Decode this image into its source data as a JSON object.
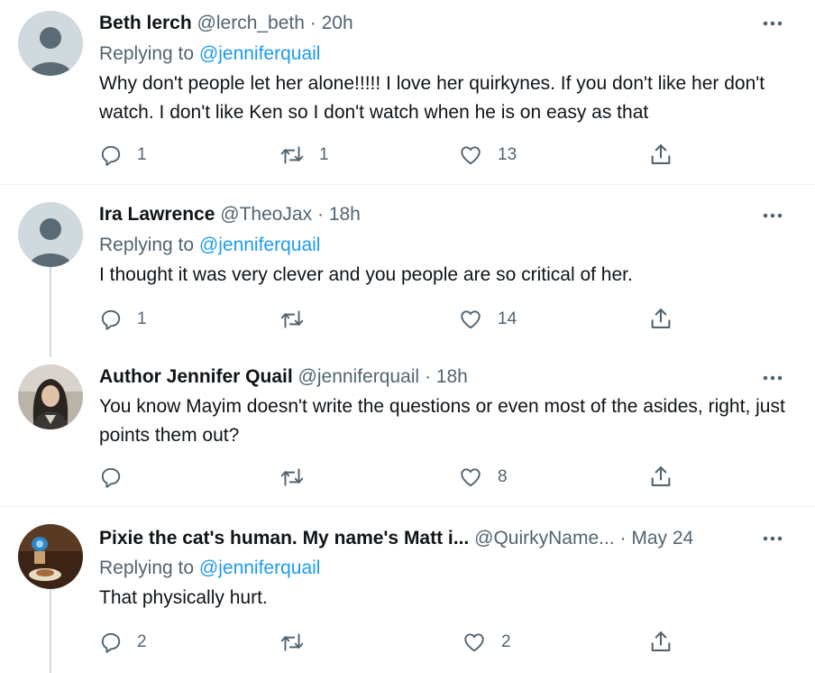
{
  "tweets": [
    {
      "display_name": "Beth lerch",
      "handle": "@lerch_beth",
      "time": "20h",
      "replying_label": "Replying to",
      "replying_to": "@jenniferquail",
      "text": "Why don't people let her alone!!!!! I love her quirkynes. If you don't like her don't watch. I don't like Ken so I don't watch when he is on easy as that",
      "reply_count": "1",
      "retweet_count": "1",
      "like_count": "13",
      "avatar": "default-avatar"
    },
    {
      "display_name": "Ira Lawrence",
      "handle": "@TheoJax",
      "time": "18h",
      "replying_label": "Replying to",
      "replying_to": "@jenniferquail",
      "text": "I thought it was very clever and you people are so critical of her.",
      "reply_count": "1",
      "retweet_count": "",
      "like_count": "14",
      "avatar": "default-avatar"
    },
    {
      "display_name": "Author Jennifer Quail",
      "handle": "@jenniferquail",
      "time": "18h",
      "text": "You know Mayim doesn't write the questions or even most of the asides, right, just points them out?",
      "reply_count": "",
      "retweet_count": "",
      "like_count": "8",
      "avatar": "photo-avatar"
    },
    {
      "display_name": "Pixie the cat's human. My name's Matt i...",
      "handle": "@QuirkyName...",
      "time": "May 24",
      "replying_label": "Replying to",
      "replying_to": "@jenniferquail",
      "text": "That physically hurt.",
      "reply_count": "2",
      "retweet_count": "",
      "like_count": "2",
      "avatar": "photo-avatar"
    }
  ],
  "separator": "·",
  "icons": [
    "reply-icon",
    "retweet-icon",
    "like-icon",
    "share-icon",
    "more-icon"
  ],
  "colors": {
    "link": "#1d9bf0",
    "secondary_text": "#536471",
    "divider": "#eff3f4",
    "thread_line": "#cfd9de"
  }
}
